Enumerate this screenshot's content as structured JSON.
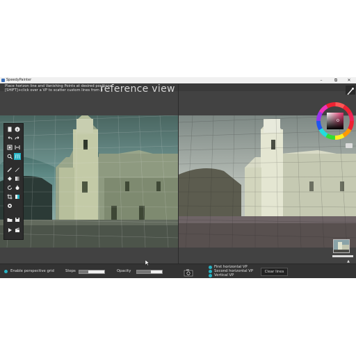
{
  "window": {
    "title": "SpeedyPainter",
    "minimize": "–",
    "maximize": "⧉",
    "close": "✕"
  },
  "hint": {
    "line1": "Place horizon line and Vanishing Points at desired positions",
    "line2": "[SHIFT]+click over a VP to scatter custom lines from it"
  },
  "reference_view_label": "reference view",
  "bottom": {
    "enable_perspective_grid": "Enable perspective grid",
    "steps_label": "Steps",
    "steps_value": 0.35,
    "opacity_label": "Opacity",
    "opacity_value": 0.55,
    "vp_options": [
      "First horizontal VP",
      "Second horizontal VP",
      "Vertical VP"
    ],
    "clear_lines": "Clear lines"
  },
  "colors": {
    "accent": "#27b3c4",
    "panel": "#3a3a3a",
    "bottom": "#333333"
  },
  "icons": [
    "new-doc-icon",
    "info-icon",
    "undo-icon",
    "redo-icon",
    "frame-icon",
    "fit-icon",
    "zoom-icon",
    "grid-icon",
    "brush-icon",
    "pencil-icon",
    "fill-icon",
    "gradient-icon",
    "rotate-icon",
    "eyedropper-icon",
    "crop-icon",
    "mirror-icon",
    "color-icon",
    "folder-icon",
    "save-icon",
    "play-icon",
    "clapper-icon"
  ]
}
